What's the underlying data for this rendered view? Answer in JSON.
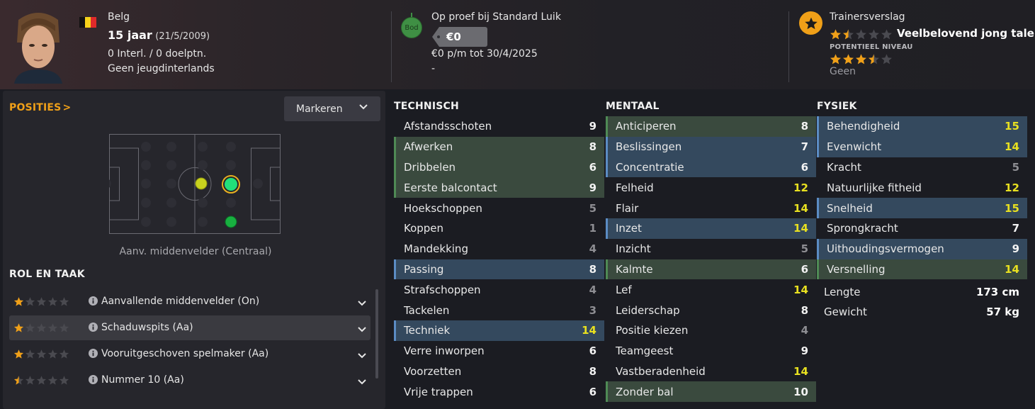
{
  "colors": {
    "accent": "#f0a018",
    "green_highlight": "#3a4a3e",
    "blue_highlight": "#34495e",
    "yellow_value": "#e8e020",
    "grey_value": "#8e8e93"
  },
  "player": {
    "nationality": "Belg",
    "age": "15 jaar",
    "birthdate": "(21/5/2009)",
    "caps": "0 Interl. / 0 doelptn.",
    "youth_caps": "Geen jeugdinterlands"
  },
  "contract": {
    "status": "Op proef bij Standard Luik",
    "bid_badge": "Bod",
    "value": "€0",
    "wage": "€0 p/m tot 30/4/2025",
    "extra": "-"
  },
  "report": {
    "title": "Trainersverslag",
    "verdict": "Veelbelovend jong talent",
    "potential_label": "POTENTIEEL NIVEAU",
    "current_stars": 1.5,
    "potential_stars": 3.5,
    "footer": "Geen"
  },
  "positions": {
    "title": "POSITIES",
    "title_arrow": ">",
    "mark_button": "Markeren",
    "caption": "Aanv. middenvelder (Centraal)"
  },
  "roles": {
    "title": "ROL EN TAAK",
    "items": [
      {
        "name": "Aanvallende middenvelder (On)",
        "stars": 1
      },
      {
        "name": "Schaduwspits (Aa)",
        "stars": 1
      },
      {
        "name": "Vooruitgeschoven spelmaker (Aa)",
        "stars": 1
      },
      {
        "name": "Nummer 10 (Aa)",
        "stars": 0.5
      }
    ]
  },
  "technical": {
    "title": "TECHNISCH",
    "attrs": [
      {
        "name": "Afstandsschoten",
        "value": "9",
        "hl": "",
        "tone": "white"
      },
      {
        "name": "Afwerken",
        "value": "8",
        "hl": "green",
        "tone": "white"
      },
      {
        "name": "Dribbelen",
        "value": "6",
        "hl": "green",
        "tone": "white"
      },
      {
        "name": "Eerste balcontact",
        "value": "9",
        "hl": "green",
        "tone": "white"
      },
      {
        "name": "Hoekschoppen",
        "value": "5",
        "hl": "",
        "tone": "grey"
      },
      {
        "name": "Koppen",
        "value": "1",
        "hl": "",
        "tone": "grey"
      },
      {
        "name": "Mandekking",
        "value": "4",
        "hl": "",
        "tone": "grey"
      },
      {
        "name": "Passing",
        "value": "8",
        "hl": "blue",
        "tone": "white"
      },
      {
        "name": "Strafschoppen",
        "value": "4",
        "hl": "",
        "tone": "grey"
      },
      {
        "name": "Tackelen",
        "value": "3",
        "hl": "",
        "tone": "grey"
      },
      {
        "name": "Techniek",
        "value": "14",
        "hl": "blue",
        "tone": "yellow"
      },
      {
        "name": "Verre inworpen",
        "value": "6",
        "hl": "",
        "tone": "white"
      },
      {
        "name": "Voorzetten",
        "value": "8",
        "hl": "",
        "tone": "white"
      },
      {
        "name": "Vrije trappen",
        "value": "6",
        "hl": "",
        "tone": "white"
      }
    ]
  },
  "mental": {
    "title": "MENTAAL",
    "attrs": [
      {
        "name": "Anticiperen",
        "value": "8",
        "hl": "green",
        "tone": "white"
      },
      {
        "name": "Beslissingen",
        "value": "7",
        "hl": "blue",
        "tone": "white"
      },
      {
        "name": "Concentratie",
        "value": "6",
        "hl": "blue",
        "tone": "white"
      },
      {
        "name": "Felheid",
        "value": "12",
        "hl": "",
        "tone": "yellow"
      },
      {
        "name": "Flair",
        "value": "14",
        "hl": "",
        "tone": "yellow"
      },
      {
        "name": "Inzet",
        "value": "14",
        "hl": "blue",
        "tone": "yellow"
      },
      {
        "name": "Inzicht",
        "value": "5",
        "hl": "",
        "tone": "grey"
      },
      {
        "name": "Kalmte",
        "value": "6",
        "hl": "green",
        "tone": "white"
      },
      {
        "name": "Lef",
        "value": "14",
        "hl": "",
        "tone": "yellow"
      },
      {
        "name": "Leiderschap",
        "value": "8",
        "hl": "",
        "tone": "white"
      },
      {
        "name": "Positie kiezen",
        "value": "4",
        "hl": "",
        "tone": "grey"
      },
      {
        "name": "Teamgeest",
        "value": "9",
        "hl": "",
        "tone": "white"
      },
      {
        "name": "Vastberadenheid",
        "value": "14",
        "hl": "",
        "tone": "yellow"
      },
      {
        "name": "Zonder bal",
        "value": "10",
        "hl": "green",
        "tone": "white"
      }
    ]
  },
  "physical": {
    "title": "FYSIEK",
    "attrs": [
      {
        "name": "Behendigheid",
        "value": "15",
        "hl": "blue",
        "tone": "yellow"
      },
      {
        "name": "Evenwicht",
        "value": "14",
        "hl": "blue",
        "tone": "yellow"
      },
      {
        "name": "Kracht",
        "value": "5",
        "hl": "",
        "tone": "grey"
      },
      {
        "name": "Natuurlijke fitheid",
        "value": "12",
        "hl": "",
        "tone": "yellow"
      },
      {
        "name": "Snelheid",
        "value": "15",
        "hl": "blue",
        "tone": "yellow"
      },
      {
        "name": "Sprongkracht",
        "value": "7",
        "hl": "",
        "tone": "white"
      },
      {
        "name": "Uithoudingsvermogen",
        "value": "9",
        "hl": "blue",
        "tone": "white"
      },
      {
        "name": "Versnelling",
        "value": "14",
        "hl": "green",
        "tone": "yellow"
      }
    ],
    "length_label": "Lengte",
    "length_value": "173 cm",
    "weight_label": "Gewicht",
    "weight_value": "57 kg"
  }
}
